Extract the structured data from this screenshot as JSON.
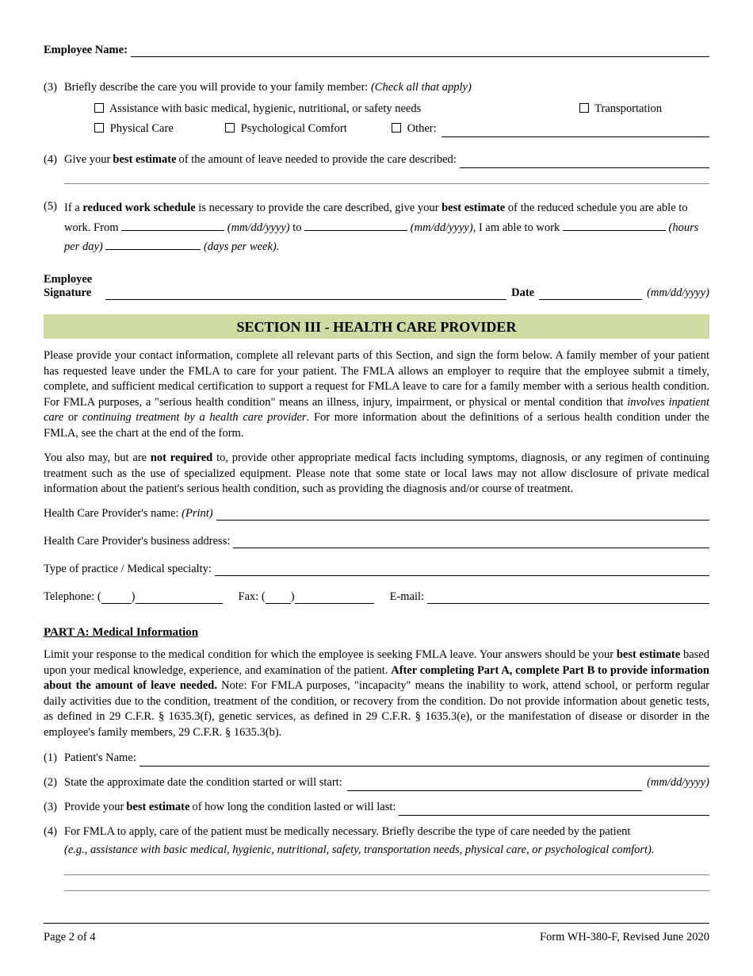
{
  "header": {
    "employee_name_label": "Employee Name:"
  },
  "q3": {
    "num": "(3)",
    "text": "Briefly describe the care you will provide to your family member:",
    "hint": "(Check all that apply)",
    "opt1": "Assistance with basic medical, hygienic, nutritional, or safety needs",
    "opt2": "Transportation",
    "opt3": "Physical Care",
    "opt4": "Psychological Comfort",
    "opt5": "Other:"
  },
  "q4": {
    "num": "(4)",
    "pre": "Give your ",
    "bold": "best estimate",
    "post": " of the amount of leave needed to provide the care described:"
  },
  "q5": {
    "num": "(5)",
    "t1": "If a ",
    "b1": "reduced work schedule",
    "t2": " is necessary to provide the care described, give your ",
    "b2": "best estimate",
    "t3": " of the reduced schedule you are able to work. From ",
    "mm1": "(mm/dd/yyyy)",
    "to": " to ",
    "mm2": "(mm/dd/yyyy),",
    "t4": " I am able to work ",
    "hpd": "(hours per day)",
    "dpw": "(days per week)."
  },
  "sig": {
    "emp1": "Employee",
    "emp2": "Signature",
    "date": "Date",
    "datehint": "(mm/dd/yyyy)"
  },
  "section3": {
    "title": "SECTION III - HEALTH CARE PROVIDER",
    "p1a": "Please provide your contact information, complete all relevant parts of this Section, and sign the form below. A family member of your patient has requested leave under the FMLA to care for your patient. The FMLA allows an employer to require that the employee submit a timely, complete, and sufficient medical certification to support a request for FMLA leave to care for a family member with a serious health condition.  For FMLA purposes, a \"serious health condition\" means an illness, injury, impairment, or physical or mental condition that ",
    "p1b": "involves inpatient care",
    "p1c": " or ",
    "p1d": "continuing treatment by a health care provider",
    "p1e": ". For more information about the definitions of a serious health condition under the FMLA, see the chart at the end of the form.",
    "p2a": "You also may, but are ",
    "p2b": "not required",
    "p2c": " to, provide other appropriate medical facts including symptoms, diagnosis, or any regimen of continuing treatment such as the use of specialized equipment. Please note that some state or local laws may not allow disclosure of private medical information about the patient's serious health condition, such as providing the diagnosis and/or course of treatment.",
    "f1a": "Health Care Provider's name: ",
    "f1b": "(Print)",
    "f2": "Health Care Provider's business address:",
    "f3": "Type of practice / Medical specialty:",
    "tel": "Telephone: (",
    "fax": "Fax: (",
    "paren_close": ")",
    "email": "E-mail:"
  },
  "partA": {
    "head": "PART A:  Medical Information",
    "p1a": "Limit your response to the medical condition for which the employee is seeking FMLA leave.  Your answers should be your ",
    "p1b": "best estimate",
    "p1c": " based upon your medical knowledge, experience, and examination of the patient. ",
    "p1d": "After completing Part A, complete Part B to provide information about the amount of leave needed.",
    "p1e": " Note: For FMLA purposes, \"incapacity\" means the inability to work, attend school, or perform regular daily activities due to the condition, treatment of the condition, or recovery from the condition. Do not provide information about genetic tests, as defined in 29 C.F.R. § 1635.3(f), genetic services, as defined in 29 C.F.R. § 1635.3(e), or the manifestation of disease or disorder in the employee's family members, 29 C.F.R. § 1635.3(b).",
    "q1n": "(1)",
    "q1": "Patient's Name:",
    "q2n": "(2)",
    "q2": "State the approximate date the condition started or will start:",
    "q2hint": "(mm/dd/yyyy)",
    "q3n": "(3)",
    "q3a": "Provide your ",
    "q3b": "best estimate",
    "q3c": " of how long the condition lasted or will last:",
    "q4n": "(4)",
    "q4a": "For FMLA to apply, care of the patient must be medically necessary.  Briefly describe the type of care needed by the patient",
    "q4b": "(e.g., assistance with basic medical, hygienic, nutritional, safety, transportation needs, physical care, or psychological comfort)."
  },
  "footer": {
    "left": "Page 2 of 4",
    "right": "Form WH-380-F, Revised June 2020"
  }
}
